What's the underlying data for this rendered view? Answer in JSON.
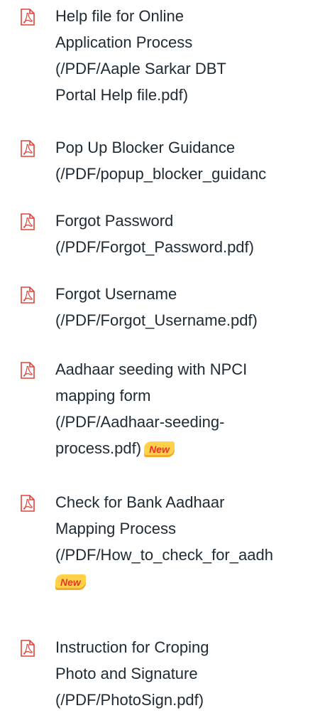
{
  "downloads": {
    "items": [
      {
        "icon": "pdf-icon",
        "lines": [
          "Help file for Online",
          "Application Process",
          "(/PDF/Aaple Sarkar DBT",
          "Portal Help file.pdf)"
        ],
        "badge": ""
      },
      {
        "icon": "pdf-icon",
        "lines": [
          "Pop Up Blocker Guidance",
          "(/PDF/popup_blocker_guidanc"
        ],
        "badge": ""
      },
      {
        "icon": "pdf-icon",
        "lines": [
          "Forgot Password",
          "(/PDF/Forgot_Password.pdf)"
        ],
        "badge": ""
      },
      {
        "icon": "pdf-icon",
        "lines": [
          "Forgot Username",
          "(/PDF/Forgot_Username.pdf)"
        ],
        "badge": ""
      },
      {
        "icon": "pdf-icon",
        "lines": [
          "Aadhaar seeding with NPCI",
          "mapping form",
          "(/PDF/Aadhaar-seeding-",
          "process.pdf)"
        ],
        "badge": "New"
      },
      {
        "icon": "pdf-icon",
        "lines": [
          "Check for Bank Aadhaar",
          "Mapping Process",
          "(/PDF/How_to_check_for_aadh"
        ],
        "badge": "New"
      },
      {
        "icon": "pdf-icon",
        "lines": [
          "Instruction for Croping",
          "Photo and Signature",
          "(/PDF/PhotoSign.pdf)"
        ],
        "badge": ""
      }
    ]
  },
  "colors": {
    "icon_red": "#e0433a",
    "text": "#1f2a33",
    "badge_bg": "#ffd24a",
    "badge_text": "#e8342a"
  }
}
